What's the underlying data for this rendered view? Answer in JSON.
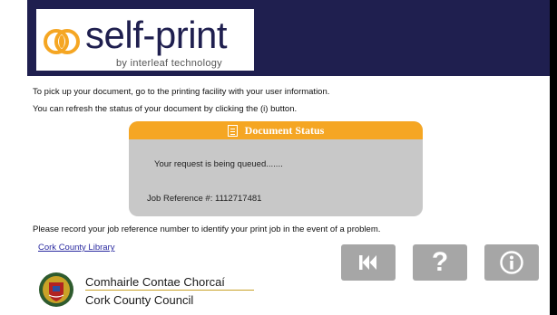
{
  "header": {
    "logo_text": "self-print",
    "logo_sub": "by interleaf technology"
  },
  "instructions": {
    "line1": "To pick up your document, go to the printing facility with your user information.",
    "line2": "You can refresh the status of your document by clicking the (i) button.",
    "line3": "Please record your job reference number to identify your print job in the event of a problem."
  },
  "status_card": {
    "title": "Document Status",
    "message": "Your request is being queued.......",
    "job_reference": "Job Reference #: 1112717481"
  },
  "library_link": "Cork County Library",
  "buttons": {
    "back_icon": "skip-back-icon",
    "help_label": "?",
    "info_icon": "info-icon"
  },
  "council": {
    "irish": "Comhairle Contae Chorcaí",
    "english": "Cork County Council"
  },
  "colors": {
    "header_bg": "#1f1f4f",
    "status_header": "#f5a623",
    "status_body": "#c8c8c8",
    "button_bg": "#a6a6a6",
    "link": "#2a2aa0"
  }
}
